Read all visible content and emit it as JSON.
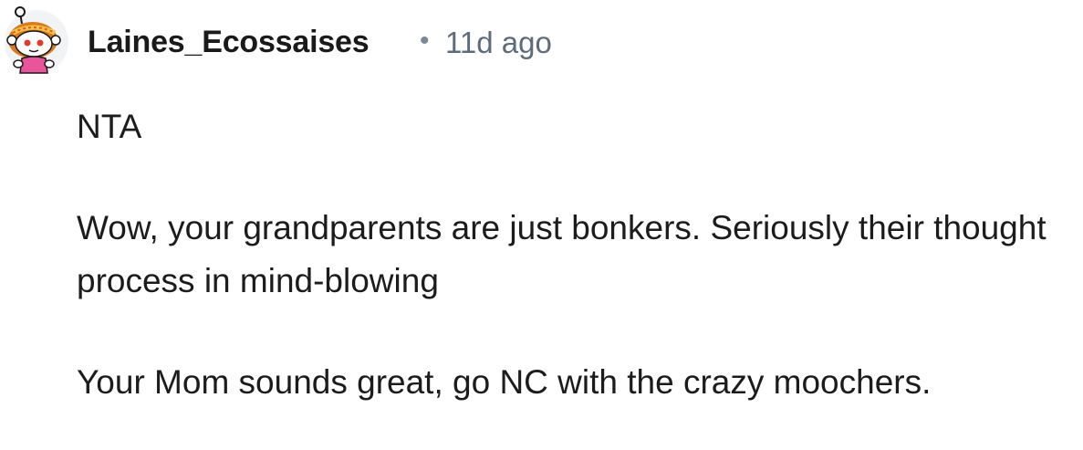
{
  "comment": {
    "author": "Laines_Ecossaises",
    "separator": "•",
    "age": "11d ago",
    "avatar_icon": "snoo-avatar-icon",
    "paragraphs": [
      "NTA",
      "Wow, your grandparents are just bonkers. Seriously their thought process in mind-blowing",
      "Your Mom sounds great, go NC with the crazy moochers."
    ]
  },
  "colors": {
    "username": "#1a1a1b",
    "timestamp": "#5c6c7a",
    "body_text": "#1c1c1c",
    "avatar_hair": "#d97a1e",
    "avatar_shirt": "#e8559a"
  }
}
